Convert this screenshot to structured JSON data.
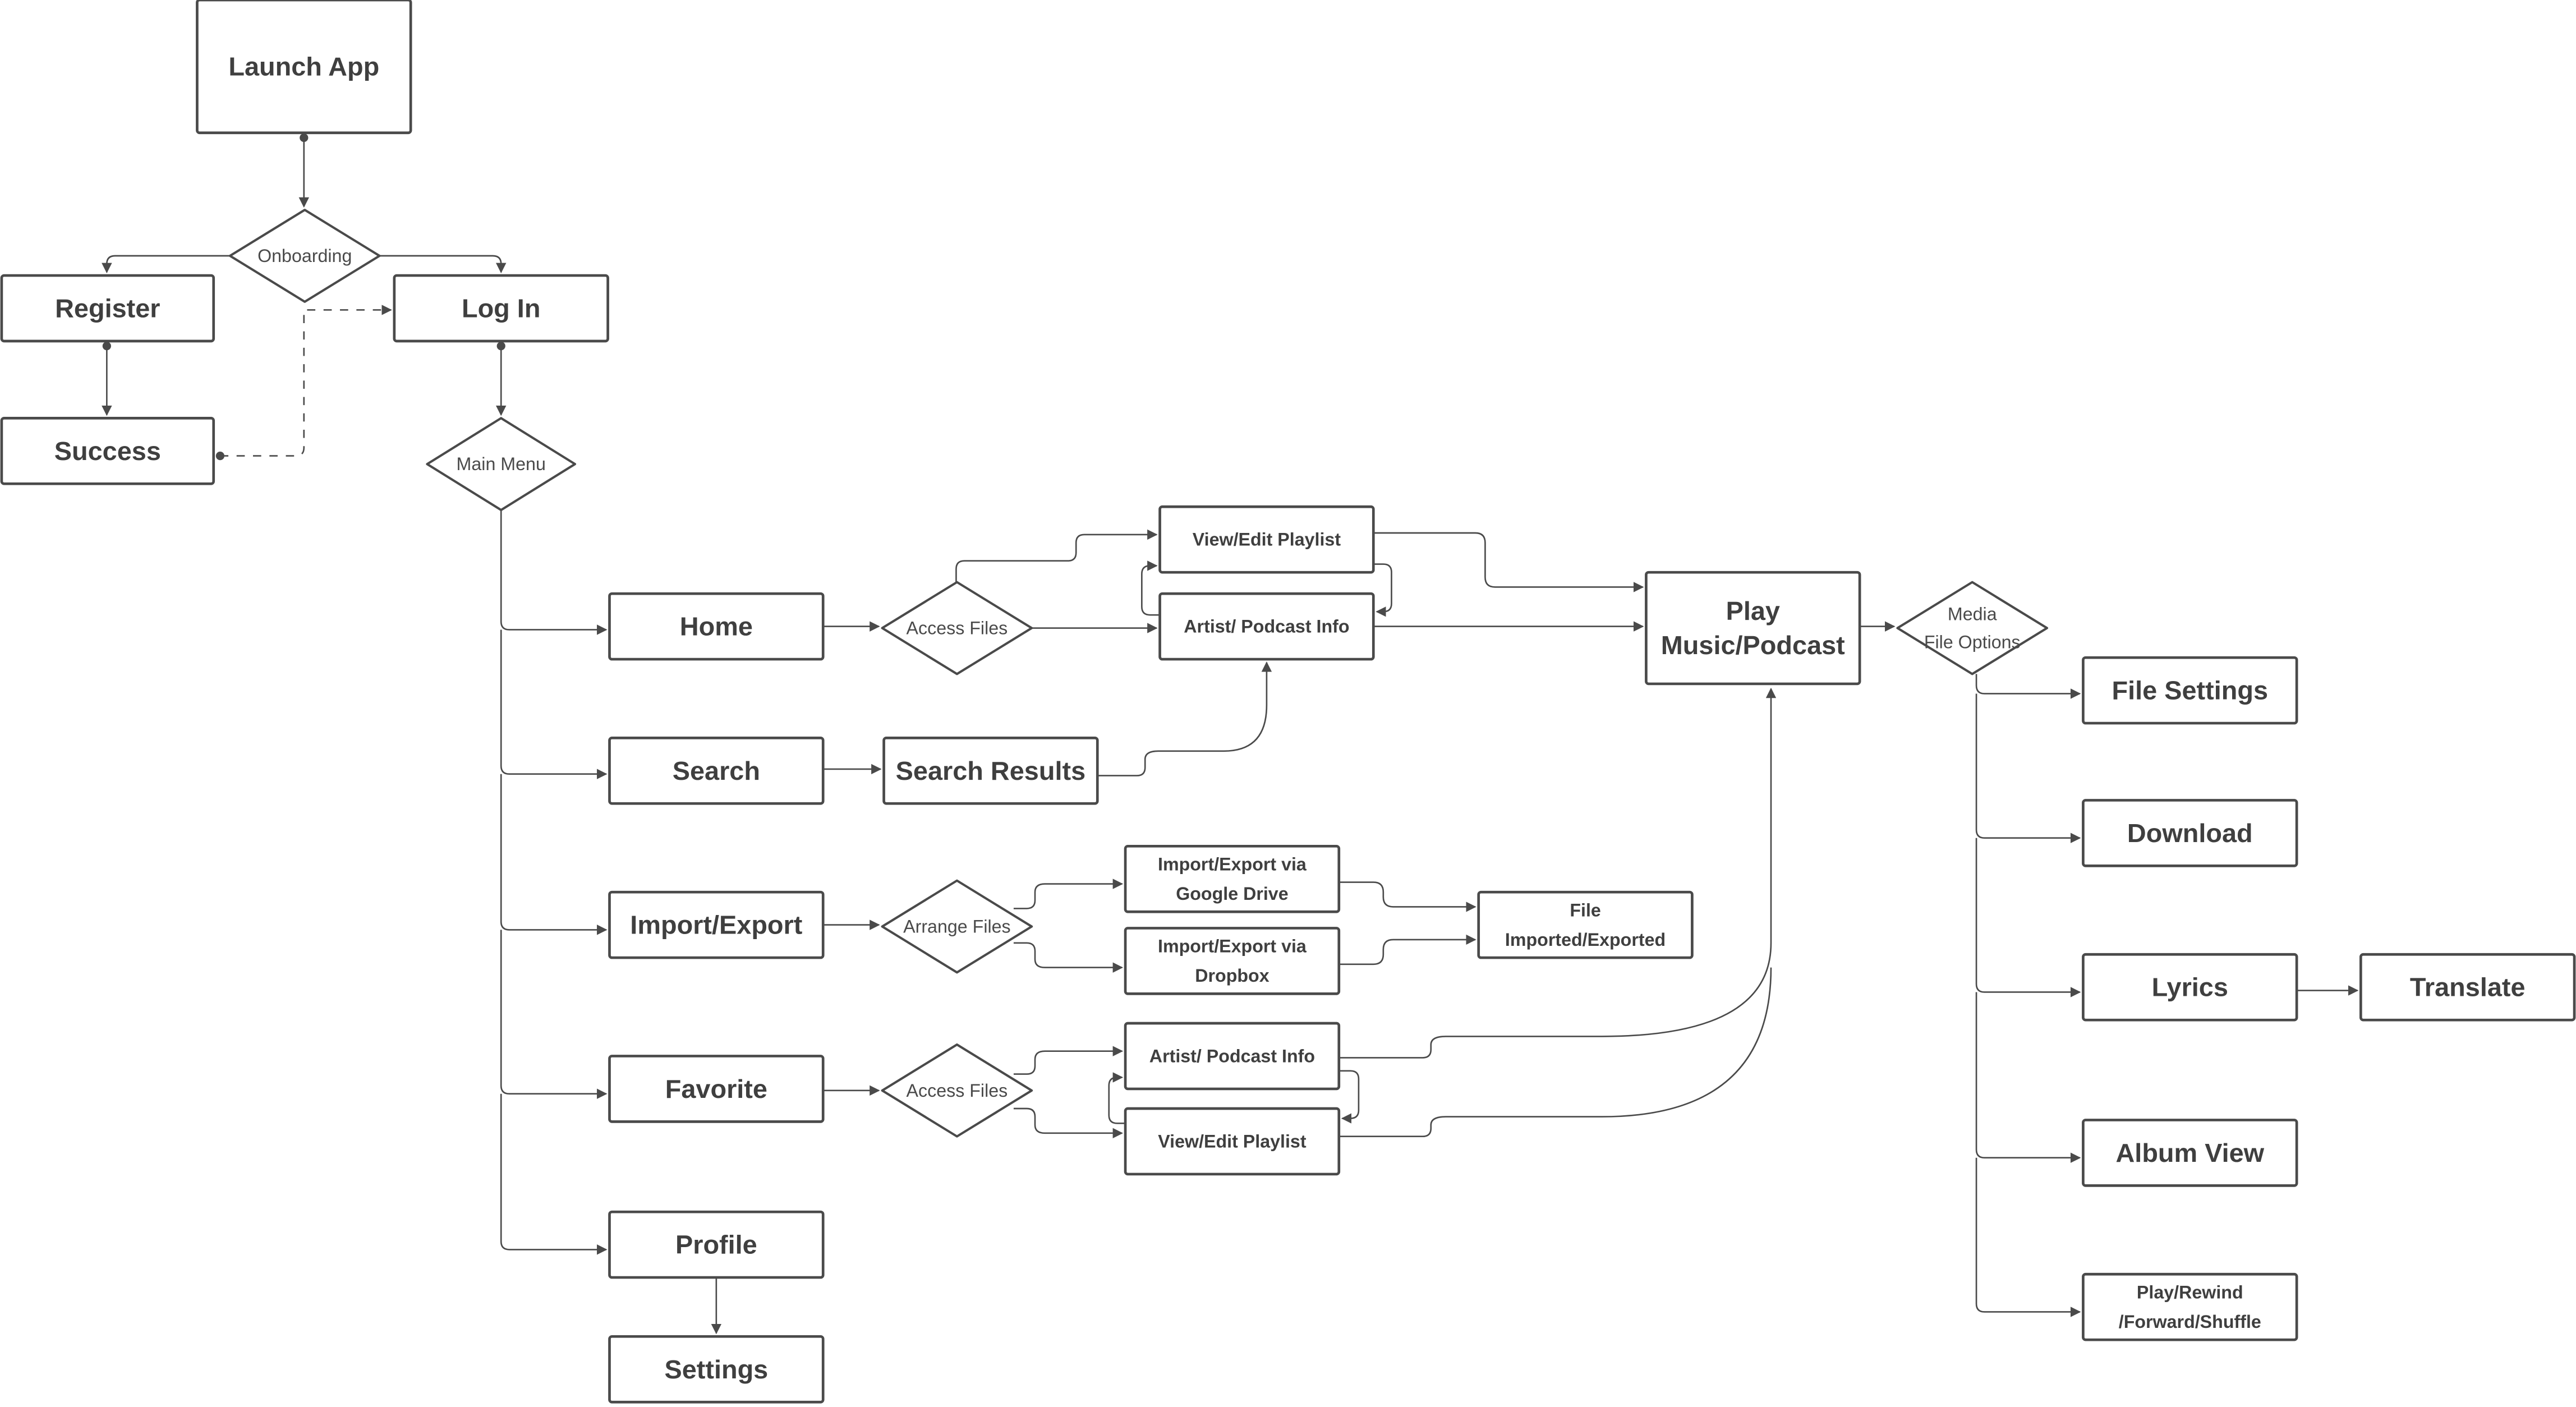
{
  "diagram": {
    "type": "user-flow",
    "colors": {
      "stroke": "#4a4a4a",
      "text": "#3f3f3f",
      "background": "#ffffff"
    },
    "nodes": {
      "launch_app": {
        "label": [
          "Launch App"
        ],
        "shape": "rect"
      },
      "onboarding": {
        "label": [
          "Onboarding"
        ],
        "shape": "diamond"
      },
      "register": {
        "label": [
          "Register"
        ],
        "shape": "rect"
      },
      "log_in": {
        "label": [
          "Log In"
        ],
        "shape": "rect"
      },
      "success": {
        "label": [
          "Success"
        ],
        "shape": "rect"
      },
      "main_menu": {
        "label": [
          "Main Menu"
        ],
        "shape": "diamond"
      },
      "home": {
        "label": [
          "Home"
        ],
        "shape": "rect"
      },
      "search": {
        "label": [
          "Search"
        ],
        "shape": "rect"
      },
      "import_export": {
        "label": [
          "Import/Export"
        ],
        "shape": "rect"
      },
      "favorite": {
        "label": [
          "Favorite"
        ],
        "shape": "rect"
      },
      "profile": {
        "label": [
          "Profile"
        ],
        "shape": "rect"
      },
      "settings": {
        "label": [
          "Settings"
        ],
        "shape": "rect"
      },
      "access_files_home": {
        "label": [
          "Access Files"
        ],
        "shape": "diamond"
      },
      "search_results": {
        "label": [
          "Search Results"
        ],
        "shape": "rect"
      },
      "arrange_files": {
        "label": [
          "Arrange Files"
        ],
        "shape": "diamond"
      },
      "access_files_fav": {
        "label": [
          "Access Files"
        ],
        "shape": "diamond"
      },
      "view_edit_playlist_home": {
        "label": [
          "View/Edit Playlist"
        ],
        "shape": "rect"
      },
      "artist_podcast_info_home": {
        "label": [
          "Artist/ Podcast Info"
        ],
        "shape": "rect"
      },
      "import_export_gdrive": {
        "label": [
          "Import/Export via",
          "Google Drive"
        ],
        "shape": "rect"
      },
      "import_export_dropbox": {
        "label": [
          "Import/Export via",
          "Dropbox"
        ],
        "shape": "rect"
      },
      "file_imported_exported": {
        "label": [
          "File",
          "Imported/Exported"
        ],
        "shape": "rect"
      },
      "artist_podcast_info_fav": {
        "label": [
          "Artist/ Podcast Info"
        ],
        "shape": "rect"
      },
      "view_edit_playlist_fav": {
        "label": [
          "View/Edit Playlist"
        ],
        "shape": "rect"
      },
      "play_music_podcast": {
        "label": [
          "Play",
          "Music/Podcast"
        ],
        "shape": "rect"
      },
      "media_file_options": {
        "label": [
          "Media",
          "File Options"
        ],
        "shape": "diamond"
      },
      "file_settings": {
        "label": [
          "File Settings"
        ],
        "shape": "rect"
      },
      "download": {
        "label": [
          "Download"
        ],
        "shape": "rect"
      },
      "lyrics": {
        "label": [
          "Lyrics"
        ],
        "shape": "rect"
      },
      "translate": {
        "label": [
          "Translate"
        ],
        "shape": "rect"
      },
      "album_view": {
        "label": [
          "Album View"
        ],
        "shape": "rect"
      },
      "play_rewind_forward_shuffle": {
        "label": [
          "Play/Rewind",
          "/Forward/Shuffle"
        ],
        "shape": "rect"
      }
    },
    "edges": [
      {
        "from": "launch_app",
        "to": "onboarding",
        "style": "solid"
      },
      {
        "from": "onboarding",
        "to": "register",
        "style": "solid"
      },
      {
        "from": "onboarding",
        "to": "log_in",
        "style": "solid"
      },
      {
        "from": "register",
        "to": "success",
        "style": "solid"
      },
      {
        "from": "success",
        "to": "log_in",
        "style": "dashed"
      },
      {
        "from": "log_in",
        "to": "main_menu",
        "style": "solid"
      },
      {
        "from": "main_menu",
        "to": "home",
        "style": "solid"
      },
      {
        "from": "main_menu",
        "to": "search",
        "style": "solid"
      },
      {
        "from": "main_menu",
        "to": "import_export",
        "style": "solid"
      },
      {
        "from": "main_menu",
        "to": "favorite",
        "style": "solid"
      },
      {
        "from": "main_menu",
        "to": "profile",
        "style": "solid"
      },
      {
        "from": "profile",
        "to": "settings",
        "style": "solid"
      },
      {
        "from": "home",
        "to": "access_files_home",
        "style": "solid"
      },
      {
        "from": "access_files_home",
        "to": "view_edit_playlist_home",
        "style": "solid"
      },
      {
        "from": "access_files_home",
        "to": "artist_podcast_info_home",
        "style": "solid"
      },
      {
        "from": "view_edit_playlist_home",
        "to": "artist_podcast_info_home",
        "style": "solid"
      },
      {
        "from": "artist_podcast_info_home",
        "to": "view_edit_playlist_home",
        "style": "solid"
      },
      {
        "from": "search",
        "to": "search_results",
        "style": "solid"
      },
      {
        "from": "search_results",
        "to": "artist_podcast_info_home",
        "style": "solid"
      },
      {
        "from": "view_edit_playlist_home",
        "to": "play_music_podcast",
        "style": "solid"
      },
      {
        "from": "artist_podcast_info_home",
        "to": "play_music_podcast",
        "style": "solid"
      },
      {
        "from": "import_export",
        "to": "arrange_files",
        "style": "solid"
      },
      {
        "from": "arrange_files",
        "to": "import_export_gdrive",
        "style": "solid"
      },
      {
        "from": "arrange_files",
        "to": "import_export_dropbox",
        "style": "solid"
      },
      {
        "from": "import_export_gdrive",
        "to": "file_imported_exported",
        "style": "solid"
      },
      {
        "from": "import_export_dropbox",
        "to": "file_imported_exported",
        "style": "solid"
      },
      {
        "from": "favorite",
        "to": "access_files_fav",
        "style": "solid"
      },
      {
        "from": "access_files_fav",
        "to": "artist_podcast_info_fav",
        "style": "solid"
      },
      {
        "from": "access_files_fav",
        "to": "view_edit_playlist_fav",
        "style": "solid"
      },
      {
        "from": "artist_podcast_info_fav",
        "to": "view_edit_playlist_fav",
        "style": "solid"
      },
      {
        "from": "view_edit_playlist_fav",
        "to": "artist_podcast_info_fav",
        "style": "solid"
      },
      {
        "from": "artist_podcast_info_fav",
        "to": "play_music_podcast",
        "style": "solid"
      },
      {
        "from": "view_edit_playlist_fav",
        "to": "play_music_podcast",
        "style": "solid"
      },
      {
        "from": "play_music_podcast",
        "to": "media_file_options",
        "style": "solid"
      },
      {
        "from": "media_file_options",
        "to": "file_settings",
        "style": "solid"
      },
      {
        "from": "media_file_options",
        "to": "download",
        "style": "solid"
      },
      {
        "from": "media_file_options",
        "to": "lyrics",
        "style": "solid"
      },
      {
        "from": "media_file_options",
        "to": "album_view",
        "style": "solid"
      },
      {
        "from": "media_file_options",
        "to": "play_rewind_forward_shuffle",
        "style": "solid"
      },
      {
        "from": "lyrics",
        "to": "translate",
        "style": "solid"
      }
    ]
  }
}
